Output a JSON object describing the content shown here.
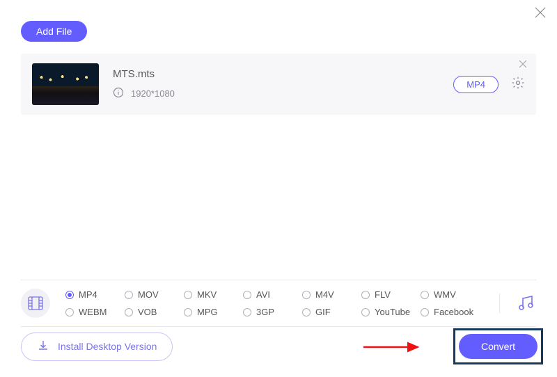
{
  "header": {
    "add_file_label": "Add File"
  },
  "file": {
    "name": "MTS.mts",
    "resolution": "1920*1080",
    "output_format": "MP4"
  },
  "formats": {
    "row1": [
      "MP4",
      "MOV",
      "MKV",
      "AVI",
      "M4V",
      "FLV",
      "WMV"
    ],
    "row2": [
      "WEBM",
      "VOB",
      "MPG",
      "3GP",
      "GIF",
      "YouTube",
      "Facebook"
    ],
    "selected": "MP4"
  },
  "footer": {
    "install_label": "Install Desktop Version",
    "convert_label": "Convert"
  }
}
